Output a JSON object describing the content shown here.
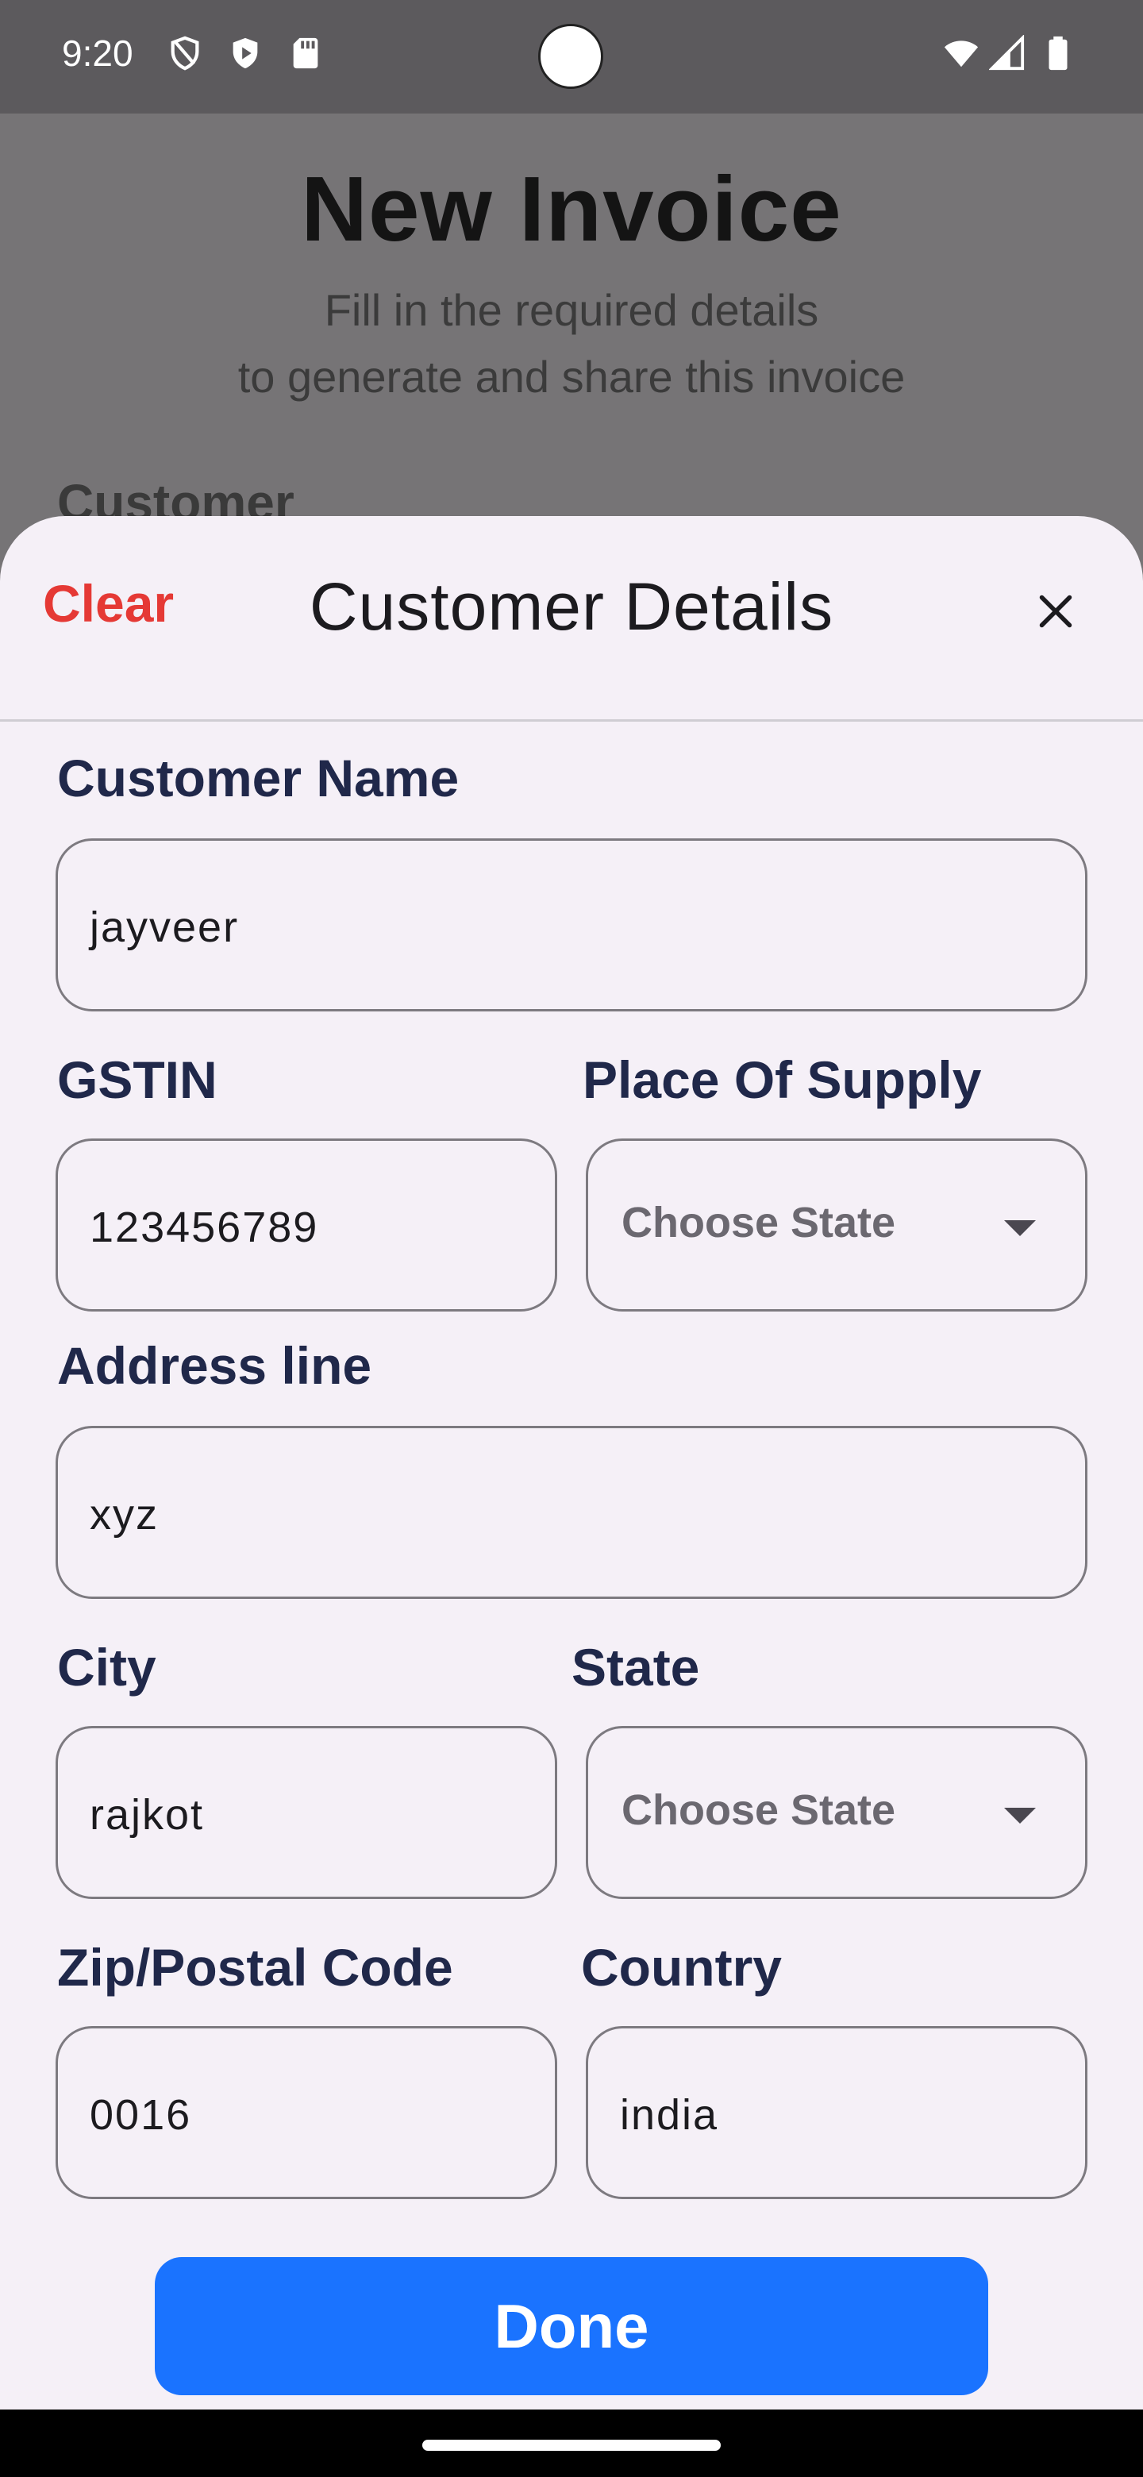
{
  "status_bar": {
    "time": "9:20"
  },
  "background": {
    "title": "New Invoice",
    "subtitle_line1": "Fill in the required details",
    "subtitle_line2": "to generate and share this invoice",
    "section_label": "Customer"
  },
  "sheet": {
    "clear_label": "Clear",
    "title": "Customer Details",
    "fields": {
      "customer_name": {
        "label": "Customer Name",
        "value": "jayveer"
      },
      "gstin": {
        "label": "GSTIN",
        "value": "123456789"
      },
      "place_of_supply": {
        "label": "Place Of Supply",
        "placeholder": "Choose State"
      },
      "address_line": {
        "label": "Address line",
        "value": "xyz"
      },
      "city": {
        "label": "City",
        "value": "rajkot"
      },
      "state": {
        "label": "State",
        "placeholder": "Choose State"
      },
      "zip": {
        "label": "Zip/Postal Code",
        "value": "0016"
      },
      "country": {
        "label": "Country",
        "value": "india"
      }
    },
    "done_label": "Done"
  },
  "colors": {
    "accent": "#1a73ff",
    "clear": "#e53935",
    "label": "#20284a"
  }
}
